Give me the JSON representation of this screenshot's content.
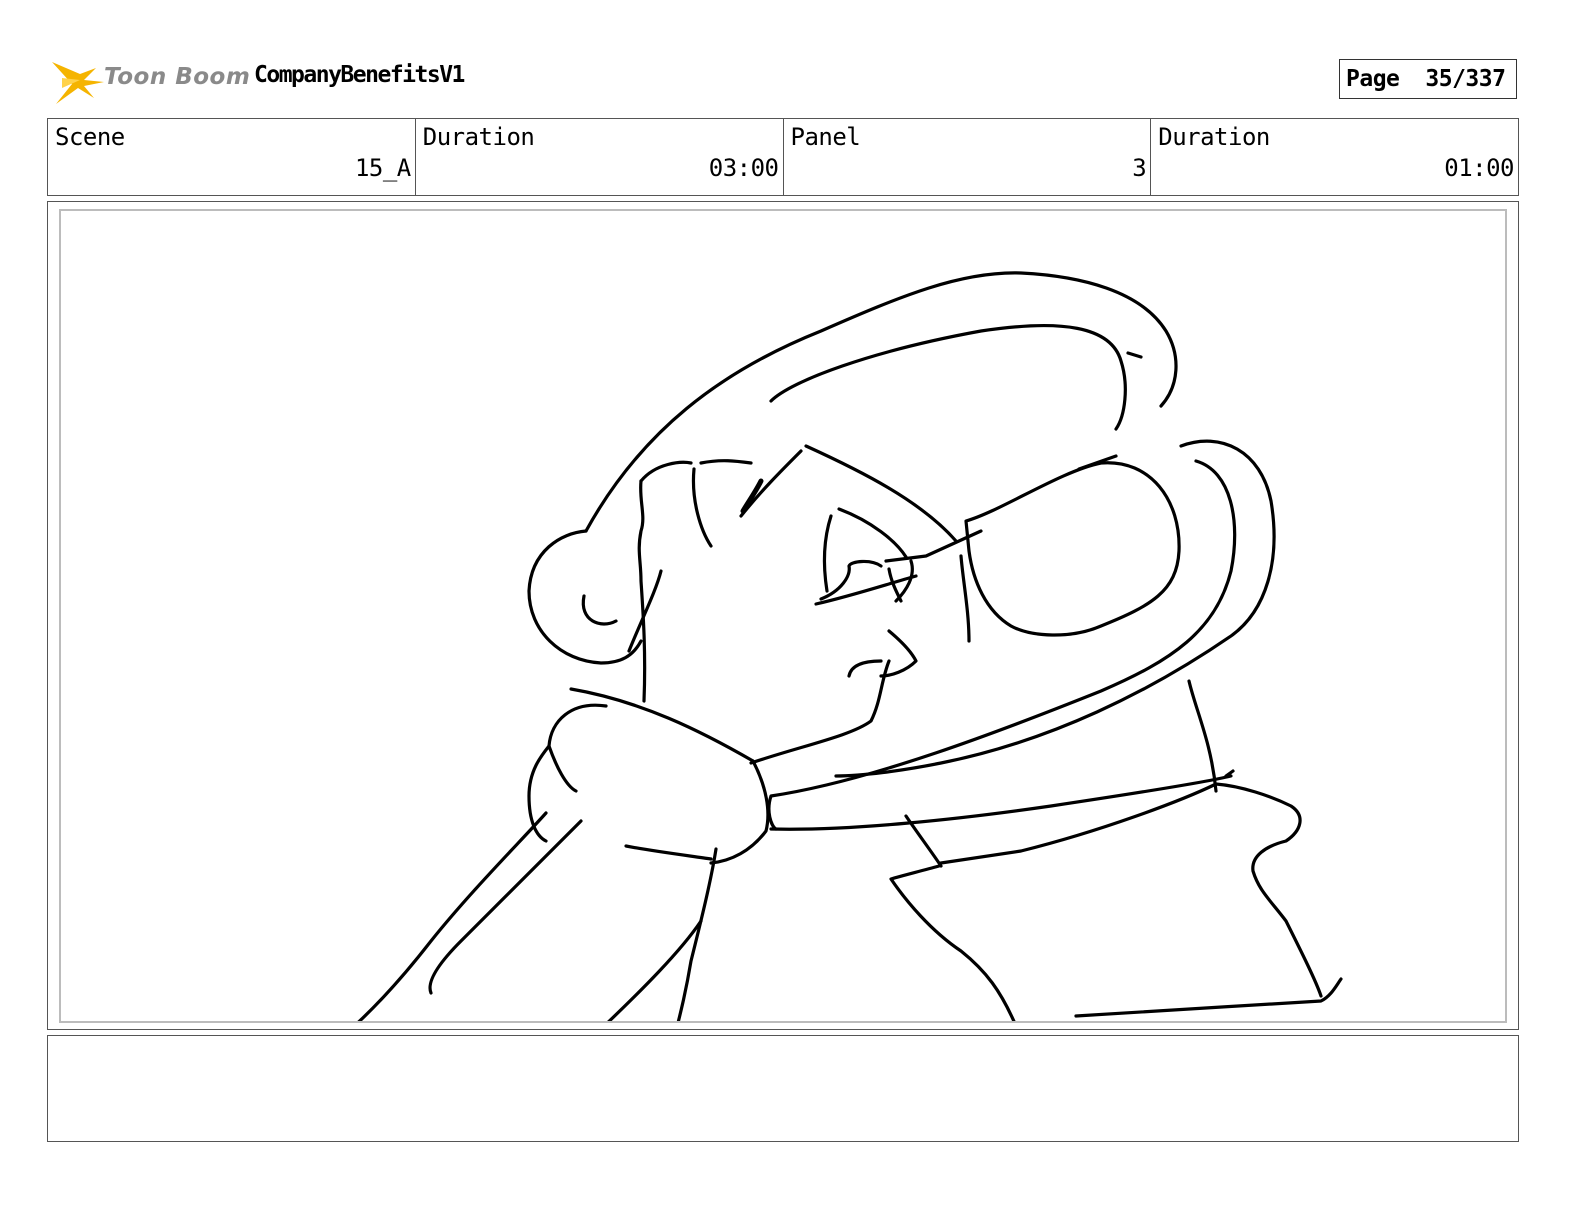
{
  "header": {
    "logo_text": "Toon Boom",
    "project_title": "CompanyBenefitsV1",
    "page_label": "Page",
    "page_number": "35/337"
  },
  "info": {
    "scene_label": "Scene",
    "scene_value": "15_A",
    "scene_duration_label": "Duration",
    "scene_duration_value": "03:00",
    "panel_label": "Panel",
    "panel_value": "3",
    "panel_duration_label": "Duration",
    "panel_duration_value": "01:00"
  },
  "notes": {
    "text": ""
  },
  "colors": {
    "logo_star": "#f5b400",
    "logo_text": "#8a8a8a",
    "border": "#555555",
    "panel_inner_border": "#bcbcbc"
  }
}
